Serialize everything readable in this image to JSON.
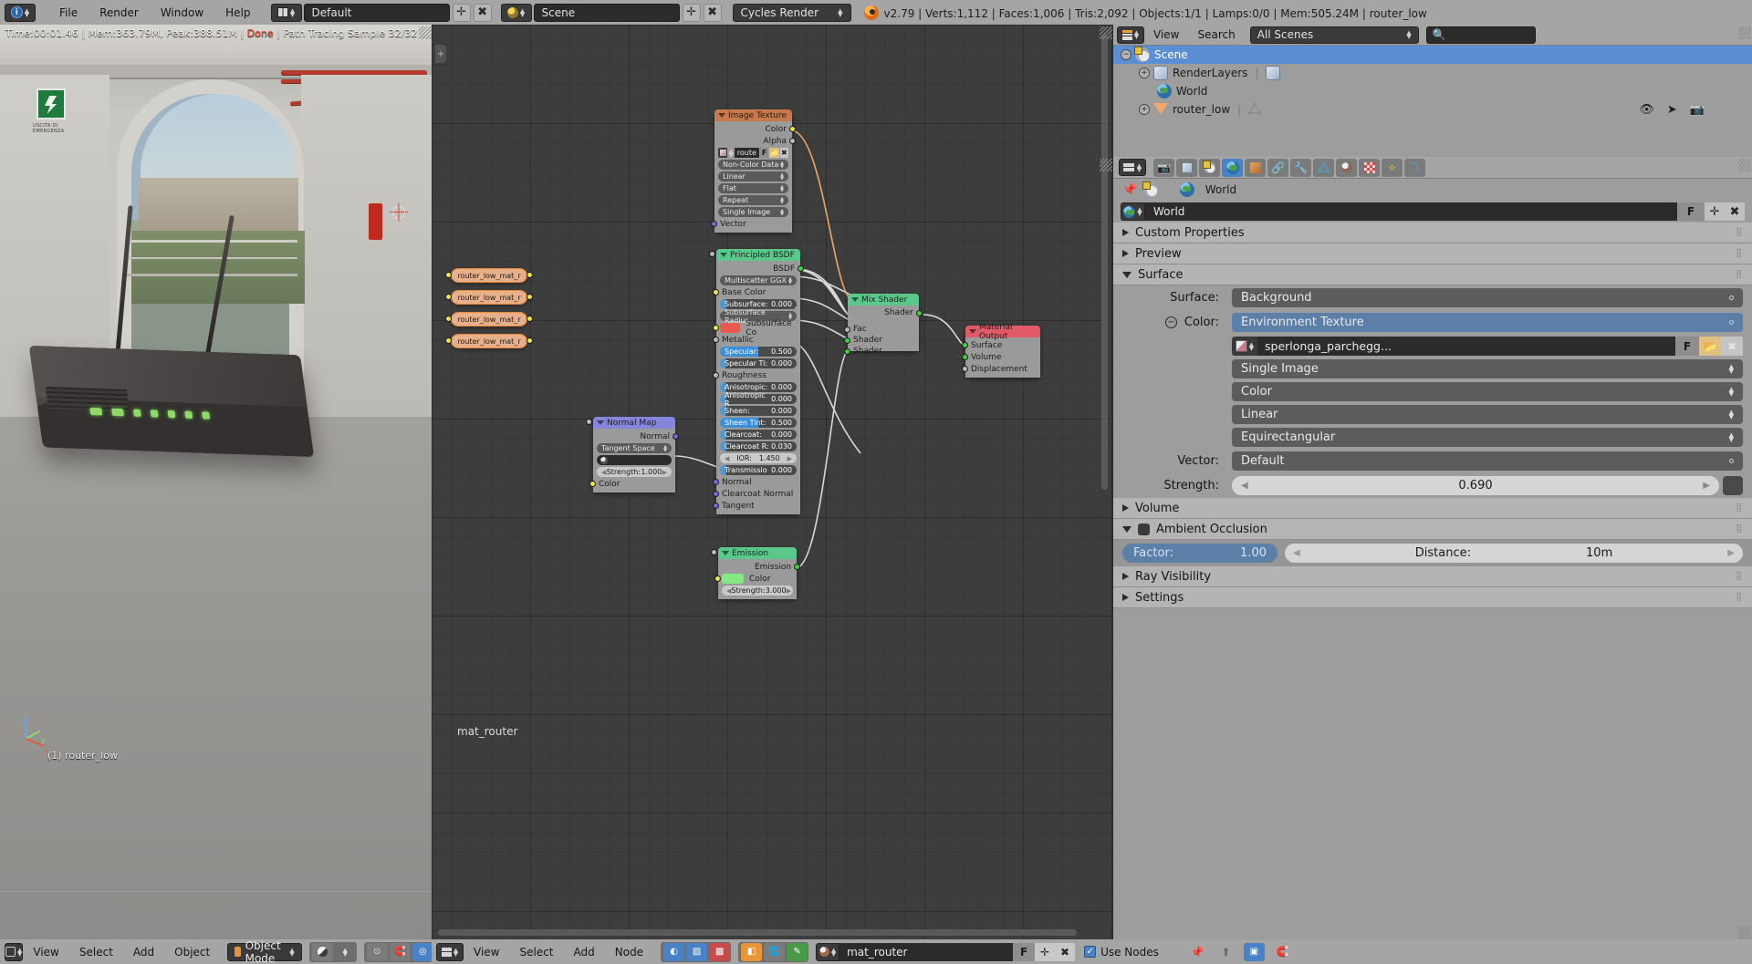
{
  "topbar": {
    "menus": [
      "File",
      "Render",
      "Window",
      "Help"
    ],
    "screen_layout": "Default",
    "scene": "Scene",
    "render_engine": "Cycles Render",
    "stats": "v2.79 | Verts:1,112 | Faces:1,006 | Tris:2,092 | Objects:1/1 | Lamps:0/0 | Mem:505.24M | router_low"
  },
  "viewport": {
    "render_info_time": "Time:00:01.46 | Mem:363.79M, Peak:388.51M | ",
    "render_info_done": "Done",
    "render_info_sample": " | Path Tracing Sample 32/32",
    "object_name": "(1) router_low",
    "axis": {
      "x": "x",
      "y": "y",
      "z": "z"
    }
  },
  "node_editor": {
    "tree_name": "mat_router",
    "nodes": [
      {
        "name": "Image Texture",
        "header_color": "#c86a3a",
        "outputs": [
          "Color",
          "Alpha"
        ],
        "image_name": "route",
        "dropdowns": [
          "Non-Color Data",
          "Linear",
          "Flat",
          "Repeat",
          "Single Image"
        ],
        "inputs": [
          "Vector"
        ],
        "buttons": [
          "F"
        ]
      },
      {
        "name": "Principled BSDF",
        "header_color": "#5ac88a",
        "outputs": [
          "BSDF"
        ],
        "distribution": "Multiscatter GGX",
        "inputs": [
          {
            "label": "Base Color",
            "type": "color-socket",
            "value": ""
          },
          {
            "label": "Subsurface:",
            "type": "slider",
            "value": "0.000"
          },
          {
            "label": "Subsurface Radius",
            "type": "dropdown",
            "value": ""
          },
          {
            "label": "Subsurface Co",
            "type": "swatch",
            "value": "#e8594f"
          },
          {
            "label": "Metallic",
            "type": "plain",
            "value": ""
          },
          {
            "label": "Specular:",
            "type": "slider",
            "value": "0.500"
          },
          {
            "label": "Specular Ti:",
            "type": "slider",
            "value": "0.000"
          },
          {
            "label": "Roughness",
            "type": "plain",
            "value": ""
          },
          {
            "label": "Anisotropic:",
            "type": "slider",
            "value": "0.000"
          },
          {
            "label": "Anisotropic R",
            "type": "slider",
            "value": "0.000"
          },
          {
            "label": "Sheen:",
            "type": "slider",
            "value": "0.000"
          },
          {
            "label": "Sheen Tint:",
            "type": "slider",
            "value": "0.500"
          },
          {
            "label": "Clearcoat:",
            "type": "slider",
            "value": "0.000"
          },
          {
            "label": "Clearcoat R:",
            "type": "slider",
            "value": "0.030"
          },
          {
            "label": "IOR:",
            "type": "numfield",
            "value": "1.450"
          },
          {
            "label": "Transmissio",
            "type": "slider",
            "value": "0.000"
          },
          {
            "label": "Normal",
            "type": "plain",
            "value": ""
          },
          {
            "label": "Clearcoat Normal",
            "type": "plain",
            "value": ""
          },
          {
            "label": "Tangent",
            "type": "plain",
            "value": ""
          }
        ]
      },
      {
        "name": "Normal Map",
        "header_color": "#7a7ad8",
        "outputs": [
          "Normal"
        ],
        "space": "Tangent Space",
        "uv_map": "",
        "strength_label": "Strength:",
        "strength_value": "1.000",
        "inputs": [
          "Color"
        ]
      },
      {
        "name": "Mix Shader",
        "header_color": "#5ac88a",
        "outputs": [
          "Shader"
        ],
        "inputs": [
          "Fac",
          "Shader",
          "Shader"
        ]
      },
      {
        "name": "Emission",
        "header_color": "#5ac88a",
        "outputs": [
          "Emission"
        ],
        "color_swatch": "#84e884",
        "color_label": "Color",
        "strength_label": "Strength:",
        "strength_value": "3.000"
      },
      {
        "name": "Material Output",
        "header_color": "#d85a6a",
        "inputs": [
          "Surface",
          "Volume",
          "Displacement"
        ]
      }
    ],
    "reroute_labels": [
      "router_low_mat_r",
      "router_low_mat_r",
      "router_low_mat_r",
      "router_low_mat_r"
    ]
  },
  "outliner": {
    "menus": [
      "View",
      "Search"
    ],
    "display_mode": "All Scenes",
    "search_placeholder": "",
    "rows": [
      {
        "label": "Scene",
        "icon": "scene-icon",
        "indent": 0,
        "selected": true,
        "expander": "minus"
      },
      {
        "label": "RenderLayers",
        "icon": "renderlayers-icon",
        "indent": 1,
        "selected": false,
        "expander": "plus"
      },
      {
        "label": "World",
        "icon": "world-icon",
        "indent": 1,
        "selected": false,
        "expander": "none"
      },
      {
        "label": "router_low",
        "icon": "mesh-icon",
        "indent": 1,
        "selected": false,
        "expander": "plus"
      }
    ]
  },
  "properties": {
    "breadcrumb_scene": "Scene",
    "breadcrumb_world": "World",
    "id_name": "World",
    "id_f": "F",
    "panels": [
      {
        "label": "Custom Properties",
        "open": false
      },
      {
        "label": "Preview",
        "open": false
      },
      {
        "label": "Surface",
        "open": true
      }
    ],
    "surface": {
      "surface_label": "Surface:",
      "surface_value": "Background",
      "color_label": "Color:",
      "color_value": "Environment Texture",
      "image_name": "sperlonga_parchegg...",
      "image_f": "F",
      "source": "Single Image",
      "color_space": "Color",
      "interpolation": "Linear",
      "projection": "Equirectangular",
      "vector_label": "Vector:",
      "vector_value": "Default",
      "strength_label": "Strength:",
      "strength_value": "0.690"
    },
    "volume_panel": "Volume",
    "ao_panel": "Ambient Occlusion",
    "ao_factor_label": "Factor:",
    "ao_factor_value": "1.00",
    "ao_distance_label": "Distance:",
    "ao_distance_value": "10m",
    "ray_visibility_panel": "Ray Visibility",
    "settings_panel": "Settings"
  },
  "bottom_3d": {
    "menus": [
      "View",
      "Select",
      "Add",
      "Object"
    ],
    "mode": "Object Mode"
  },
  "bottom_node": {
    "menus": [
      "View",
      "Select",
      "Add",
      "Node"
    ],
    "material_name": "mat_router",
    "f_label": "F",
    "use_nodes": "Use Nodes"
  },
  "colors": {
    "accent_blue": "#4a82c8",
    "header_grey": "#a5a5a5",
    "panel_grey": "#9d9d9d",
    "node_bg": "#3d3d3d"
  }
}
